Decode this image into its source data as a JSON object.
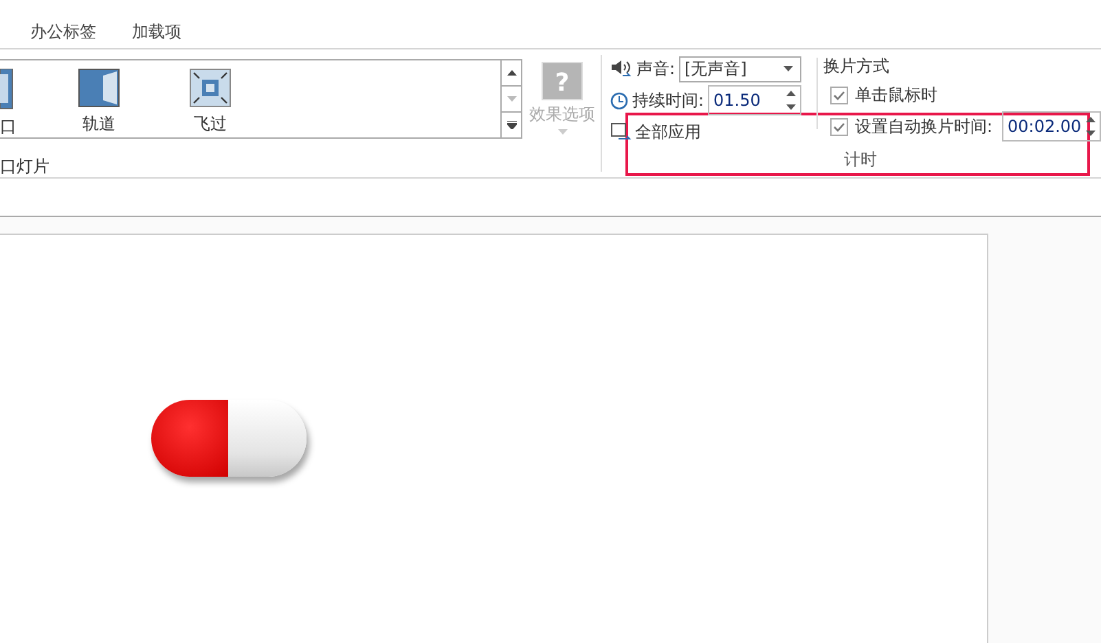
{
  "tabs": [
    "办公标签",
    "加载项"
  ],
  "transitions": {
    "items": [
      {
        "label": "口",
        "kind": "partial"
      },
      {
        "label": "轨道",
        "kind": "orbit"
      },
      {
        "label": "飞过",
        "kind": "fly"
      }
    ],
    "group_label": "口灯片"
  },
  "effect_options": {
    "icon": "?",
    "label": "效果选项",
    "disabled": true
  },
  "timing": {
    "sound": {
      "label": "声音:",
      "value": "[无声音]"
    },
    "duration": {
      "label": "持续时间:",
      "value": "01.50"
    },
    "apply_all": "全部应用",
    "advance_title": "换片方式",
    "on_click": {
      "label": "单击鼠标时",
      "checked": true
    },
    "after": {
      "label": "设置自动换片时间:",
      "checked": true,
      "value": "00:02.00"
    },
    "group_label": "计时"
  }
}
